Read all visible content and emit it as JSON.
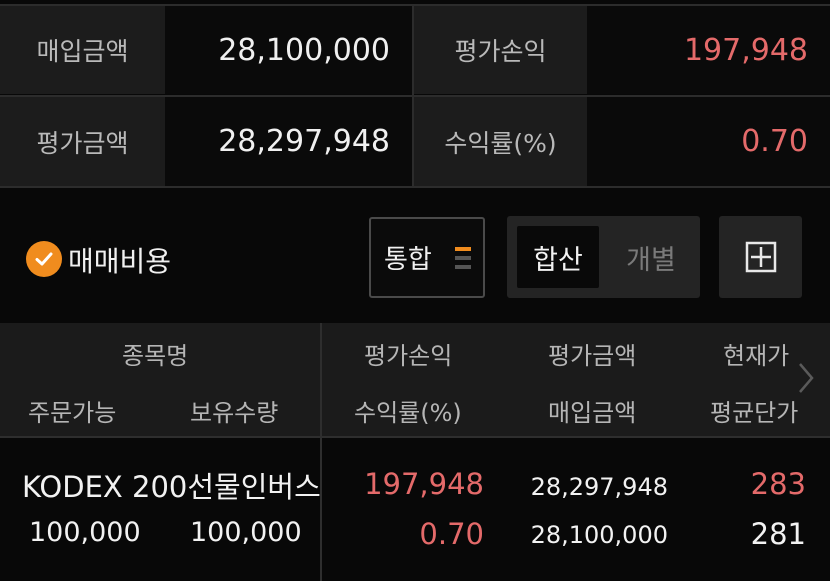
{
  "summary": {
    "purchase_amount_label": "매입금액",
    "purchase_amount_value": "28,100,000",
    "eval_pl_label": "평가손익",
    "eval_pl_value": "197,948",
    "eval_amount_label": "평가금액",
    "eval_amount_value": "28,297,948",
    "return_rate_label": "수익률(%)",
    "return_rate_value": "0.70"
  },
  "controls": {
    "fees_checkbox_checked": true,
    "fees_label": "매매비용",
    "combined_dropdown_label": "통합",
    "segment": {
      "selected": "합산",
      "other": "개별"
    },
    "add_icon": "plus-square-icon"
  },
  "table": {
    "headers": {
      "row1": {
        "name": "종목명",
        "eval_pl": "평가손익",
        "eval_amount": "평가금액",
        "current_price": "현재가"
      },
      "row2": {
        "orderable": "주문가능",
        "holding_qty": "보유수량",
        "return_rate": "수익률(%)",
        "purchase_amount": "매입금액",
        "avg_price": "평균단가"
      }
    },
    "rows": [
      {
        "name": "KODEX 200선물인버스",
        "eval_pl": "197,948",
        "eval_amount": "28,297,948",
        "current_price": "283",
        "orderable": "100,000",
        "holding_qty": "100,000",
        "return_rate": "0.70",
        "purchase_amount": "28,100,000",
        "avg_price": "281"
      }
    ]
  },
  "colors": {
    "positive": "#e46a6a",
    "accent": "#f08c1e"
  }
}
